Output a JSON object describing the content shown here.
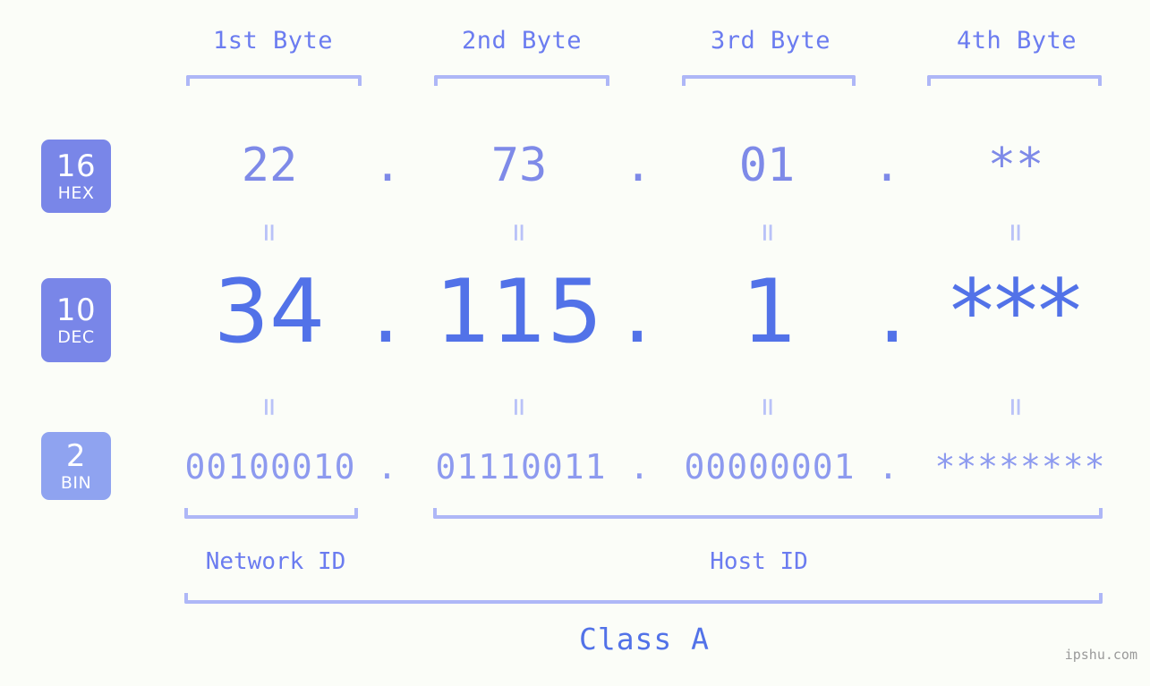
{
  "watermark": "ipshu.com",
  "byte_headers": [
    {
      "label": "1st Byte"
    },
    {
      "label": "2nd Byte"
    },
    {
      "label": "3rd Byte"
    },
    {
      "label": "4th Byte"
    }
  ],
  "bases": [
    {
      "num": "16",
      "name": "HEX"
    },
    {
      "num": "10",
      "name": "DEC"
    },
    {
      "num": "2",
      "name": "BIN"
    }
  ],
  "rows": {
    "hex": {
      "base_num": "16",
      "base_name": "HEX",
      "values": [
        "22",
        "73",
        "01",
        "**"
      ],
      "separator": "."
    },
    "dec": {
      "base_num": "10",
      "base_name": "DEC",
      "values": [
        "34",
        "115",
        "1",
        "***"
      ],
      "separator": "."
    },
    "bin": {
      "base_num": "2",
      "base_name": "BIN",
      "values": [
        "00100010",
        "01110011",
        "00000001",
        "********"
      ],
      "separator": "."
    }
  },
  "equality_marks": [
    "=",
    "=",
    "=",
    "=",
    "=",
    "=",
    "=",
    "="
  ],
  "partition": {
    "network_label": "Network ID",
    "host_label": "Host ID"
  },
  "class": {
    "label": "Class A"
  },
  "colors": {
    "background": "#fbfdf8",
    "badge_fill": "#7986e8",
    "badge_fill_light": "#8fa3f0",
    "badge_text": "#ffffff",
    "header_text": "#6b7cf0",
    "hex_text": "#7e8ae8",
    "dec_text": "#5272e8",
    "bin_text": "#8d9aef",
    "bracket": "#aeb7f7",
    "eq_mark": "#b9c2f8",
    "watermark": "#9a9a9a"
  }
}
